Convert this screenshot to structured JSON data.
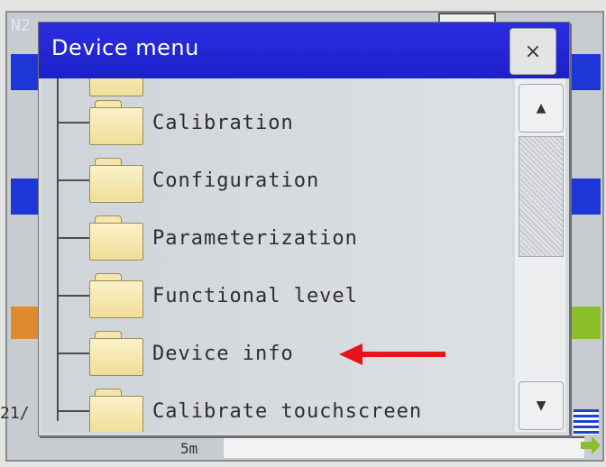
{
  "background": {
    "top_label": "N2",
    "left_number": "21/",
    "bottom_text": "5m",
    "colors": {
      "blue": "#1e35d8",
      "orange": "#e08a30",
      "green": "#8bbf2a"
    }
  },
  "dialog": {
    "title": "Device menu",
    "close_icon": "×",
    "items": [
      {
        "label": "Calibration",
        "icon": "folder-icon"
      },
      {
        "label": "Configuration",
        "icon": "folder-icon"
      },
      {
        "label": "Parameterization",
        "icon": "folder-icon"
      },
      {
        "label": "Functional level",
        "icon": "folder-icon"
      },
      {
        "label": "Device info",
        "icon": "folder-icon"
      },
      {
        "label": "Calibrate touchscreen",
        "icon": "folder-icon"
      }
    ],
    "scroll_up_icon": "▲",
    "scroll_down_icon": "▼"
  },
  "annotation": {
    "arrow_color": "#e8141c",
    "points_to": "Device info"
  }
}
